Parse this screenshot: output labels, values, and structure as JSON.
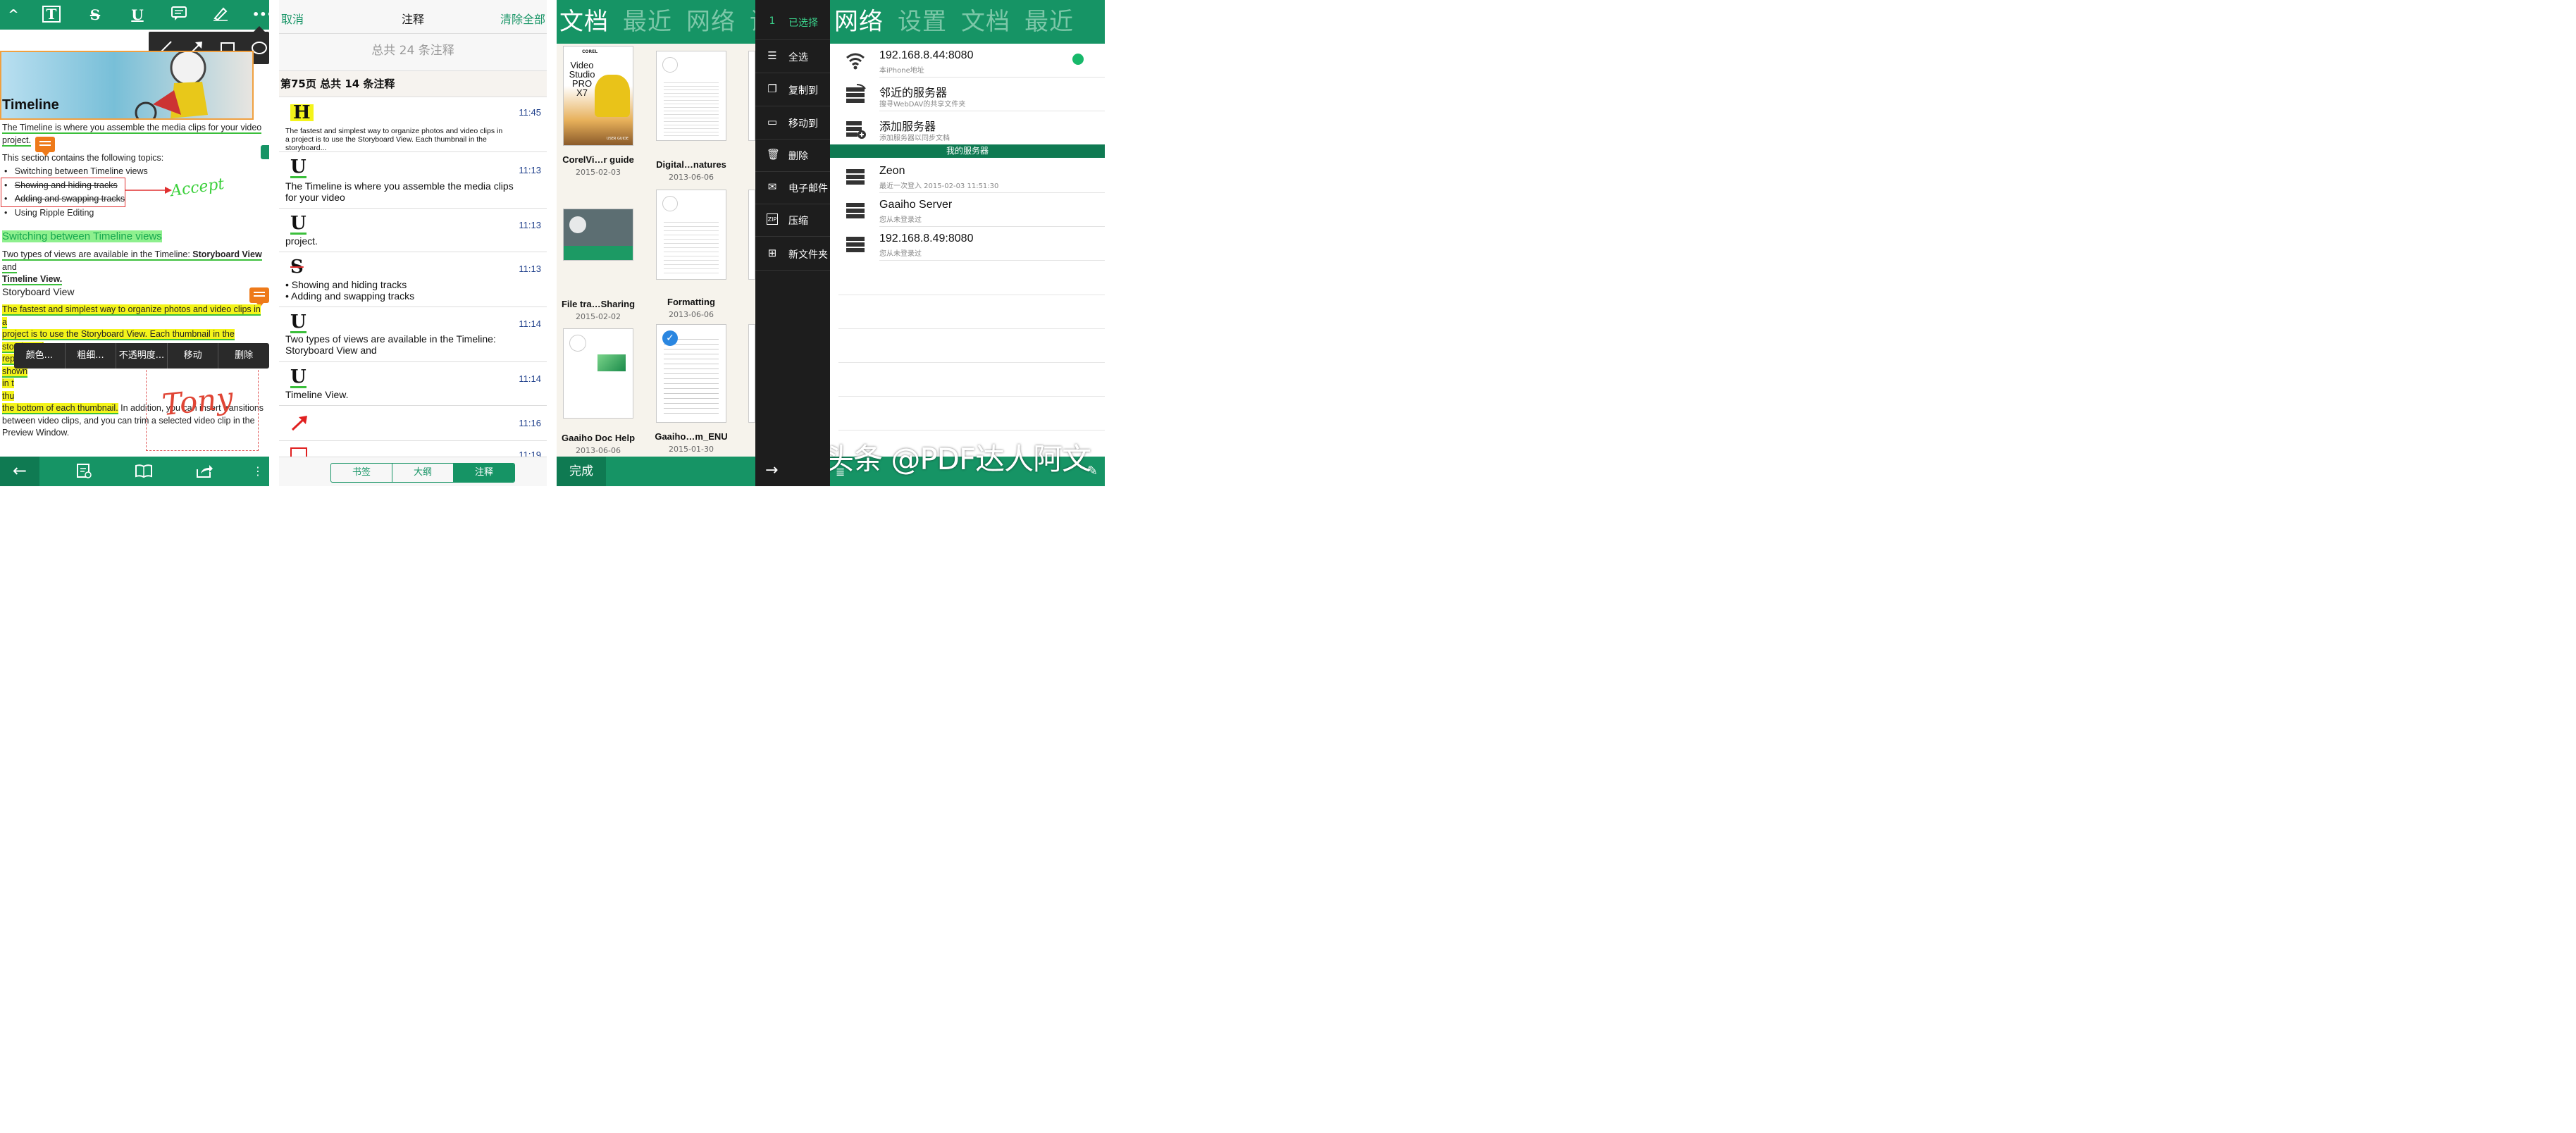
{
  "reader": {
    "toolbar": [
      "T",
      "S",
      "U"
    ],
    "hero_title": "Timeline",
    "para1_a": "The Timeline is where you assemble the media clips for your video",
    "para1_b": "project.",
    "topics_intro": "This section contains the following topics:",
    "topics": [
      "Switching between Timeline views",
      "Showing and hiding tracks",
      "Adding and swapping tracks",
      "Using Ripple Editing"
    ],
    "accept_text": "Accept",
    "section_title": "Switching between Timeline views",
    "para2_a": "Two types of views are available in the Timeline: ",
    "para2_b": "Storyboard View",
    "para2_c": " and",
    "para2_d": "Timeline View.",
    "subhead": "Storyboard View",
    "para3_lines": [
      "The fastest and simplest way to organize photos and video clips in a",
      "project is to use the Storyboard View. Each thumbnail in the storyboard",
      "represents a photo, video clip, or a transition. Thumbnails are shown",
      "in t",
      "thu",
      "the bottom of each thumbnail."
    ],
    "para3_tail": " In addition, you can insert transitions",
    "para3_more": [
      "between video clips, and you can trim a selected video clip in the",
      "Preview Window."
    ],
    "context_menu": [
      "颜色...",
      "粗细...",
      "不透明度...",
      "移动",
      "删除"
    ],
    "signature_text": "Tony"
  },
  "annotations": {
    "cancel": "取消",
    "title": "注释",
    "clear_all": "清除全部",
    "total": "总共 24 条注释",
    "page_header": "第75页 总共 14 条注释",
    "items": [
      {
        "icon": "H",
        "time": "11:45",
        "text": "The fastest and simplest way to organize photos and video clips in a project is to use the Storyboard View. Each thumbnail in the storyboard..."
      },
      {
        "icon": "U",
        "time": "11:13",
        "text": "The Timeline is where you assemble the media clips for your video"
      },
      {
        "icon": "U",
        "time": "11:13",
        "text": "project."
      },
      {
        "icon": "S",
        "time": "11:13",
        "text": "• Showing and hiding tracks\n• Adding and swapping tracks"
      },
      {
        "icon": "U",
        "time": "11:14",
        "text": "Two types of views are available in the Timeline: Storyboard View and"
      },
      {
        "icon": "U",
        "time": "11:14",
        "text": "Timeline View."
      },
      {
        "icon": "arrow",
        "time": "11:16",
        "text": ""
      },
      {
        "icon": "rect",
        "time": "11:19",
        "text": ""
      }
    ],
    "tabs": [
      "书签",
      "大纲",
      "注释"
    ],
    "active_tab": "注释"
  },
  "documents": {
    "tabs": [
      "文档",
      "最近",
      "网络",
      "设"
    ],
    "docs": [
      {
        "name": "CorelVi…r guide",
        "date": "2015-02-03"
      },
      {
        "name": "Digital…natures",
        "date": "2013-06-06"
      },
      {
        "name": "File tra…Sharing",
        "date": "2015-02-02"
      },
      {
        "name": "Formatting",
        "date": "2013-06-06"
      },
      {
        "name": "Gaaiho Doc Help",
        "date": "2013-06-06"
      },
      {
        "name": "Gaaiho…m_ENU",
        "date": "2015-01-30"
      }
    ],
    "cover_text": "Video Studio PRO X7",
    "cover_brand": "COREL",
    "cover_sub": "USER GUIDE",
    "done": "完成"
  },
  "menu": {
    "selected_count": "1",
    "selected_label": "已选择",
    "items": [
      "全选",
      "复制到",
      "移动到",
      "删除",
      "电子邮件",
      "压缩",
      "新文件夹"
    ]
  },
  "network": {
    "tabs": [
      "网络",
      "设置",
      "文档",
      "最近"
    ],
    "servers": [
      {
        "title": "192.168.8.44:8080",
        "sub": "本iPhone地址"
      },
      {
        "title": "邻近的服务器",
        "sub": "搜寻WebDAV的共享文件夹"
      },
      {
        "title": "添加服务器",
        "sub": "添加服务器以同步文档"
      }
    ],
    "section": "我的服务器",
    "my_servers": [
      {
        "title": "Zeon",
        "sub": "最近一次登入 2015-02-03 11:51:30"
      },
      {
        "title": "Gaaiho Server",
        "sub": "您从未登录过"
      },
      {
        "title": "192.168.8.49:8080",
        "sub": "您从未登录过"
      }
    ],
    "status_color": "#17b86a"
  },
  "watermark": "头条 @PDF达人阿文",
  "colors": {
    "brand": "#169465",
    "brand_dark": "#0f7a52",
    "menu_bg": "#1d1d1d"
  }
}
